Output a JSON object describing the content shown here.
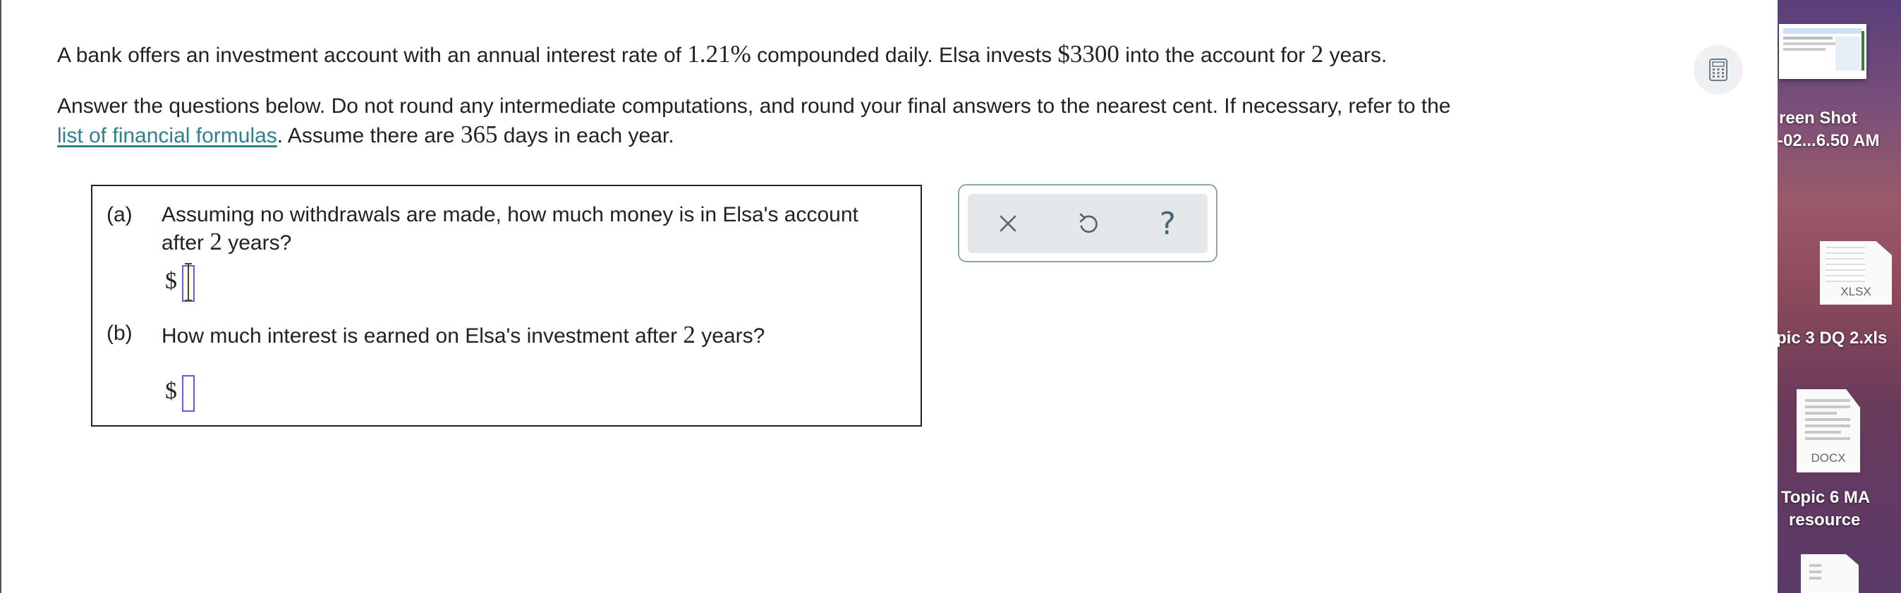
{
  "question": {
    "intro_pre": "A bank offers an investment account with an annual interest rate of ",
    "rate": "1.21%",
    "intro_mid": " compounded daily. Elsa invests ",
    "principal": "$3300",
    "intro_post": " into the account for ",
    "years": "2",
    "intro_end": " years.",
    "instr_line1": "Answer the questions below. Do not round any intermediate computations, and round your final answers to the nearest cent. If necessary, refer to the",
    "formulas_link": "list of financial formulas",
    "instr_line2_pre": ". Assume there are ",
    "days": "365",
    "instr_line2_post": " days in each year."
  },
  "parts": [
    {
      "label": "(a)",
      "text_line1": "Assuming no withdrawals are made, how much money is in Elsa's account",
      "text_line2_pre": "after ",
      "years": "2",
      "text_line2_post": " years?",
      "currency": "$",
      "answer": ""
    },
    {
      "label": "(b)",
      "text_pre": "How much interest is earned on Elsa's investment after ",
      "years": "2",
      "text_post": " years?",
      "currency": "$",
      "answer": ""
    }
  ],
  "toolbar": {
    "clear_icon": "close-icon",
    "undo_icon": "undo-icon",
    "help_label": "?"
  },
  "calculator_icon": "calculator-icon",
  "desktop": {
    "items": [
      {
        "label1": "reen Shot",
        "label2": "-02...6.50 AM",
        "kind": "screenshot"
      },
      {
        "ext": "XLSX",
        "label1": "pic 3 DQ 2.xls",
        "kind": "xlsx"
      },
      {
        "ext": "DOCX",
        "label1": "Topic 6 MA",
        "label2": "resource",
        "kind": "docx"
      }
    ]
  }
}
